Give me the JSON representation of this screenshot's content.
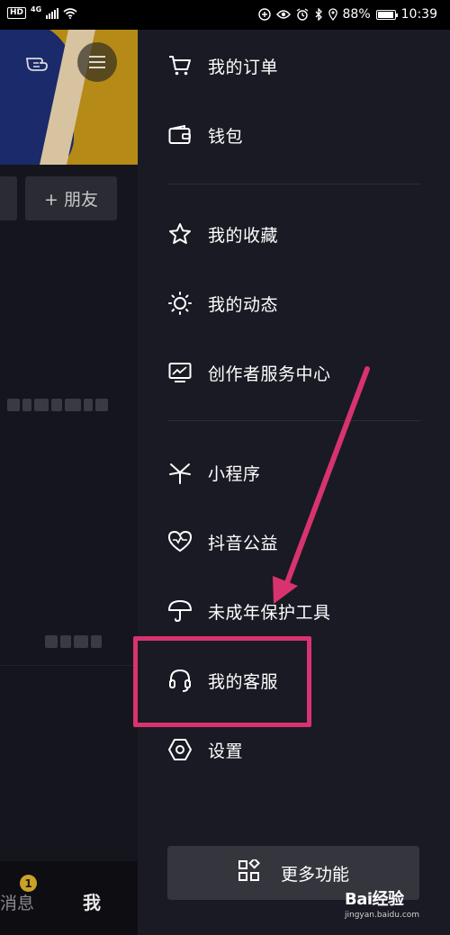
{
  "status_bar": {
    "hd": "HD",
    "network": "4G",
    "battery": "88%",
    "time": "10:39"
  },
  "left_panel": {
    "add_friend_label": "+ 朋友",
    "tabs": {
      "messages_label": "消息",
      "messages_badge": "1",
      "me_label": "我"
    }
  },
  "drawer": {
    "sections": [
      [
        {
          "icon": "cart-icon",
          "label": "我的订单"
        },
        {
          "icon": "wallet-icon",
          "label": "钱包"
        }
      ],
      [
        {
          "icon": "star-icon",
          "label": "我的收藏"
        },
        {
          "icon": "sun-icon",
          "label": "我的动态"
        },
        {
          "icon": "chart-monitor-icon",
          "label": "创作者服务中心"
        }
      ],
      [
        {
          "icon": "mini-program-icon",
          "label": "小程序"
        },
        {
          "icon": "heart-charity-icon",
          "label": "抖音公益"
        },
        {
          "icon": "umbrella-icon",
          "label": "未成年保护工具"
        },
        {
          "icon": "headset-icon",
          "label": "我的客服"
        },
        {
          "icon": "settings-hexagon-icon",
          "label": "设置"
        }
      ]
    ],
    "more_button": {
      "icon": "apps-grid-icon",
      "label": "更多功能"
    }
  },
  "annotation": {
    "highlight_color": "#d8336f",
    "highlighted_item": "我的客服"
  },
  "watermark": {
    "logo": "Bai经验",
    "url": "jingyan.baidu.com"
  }
}
